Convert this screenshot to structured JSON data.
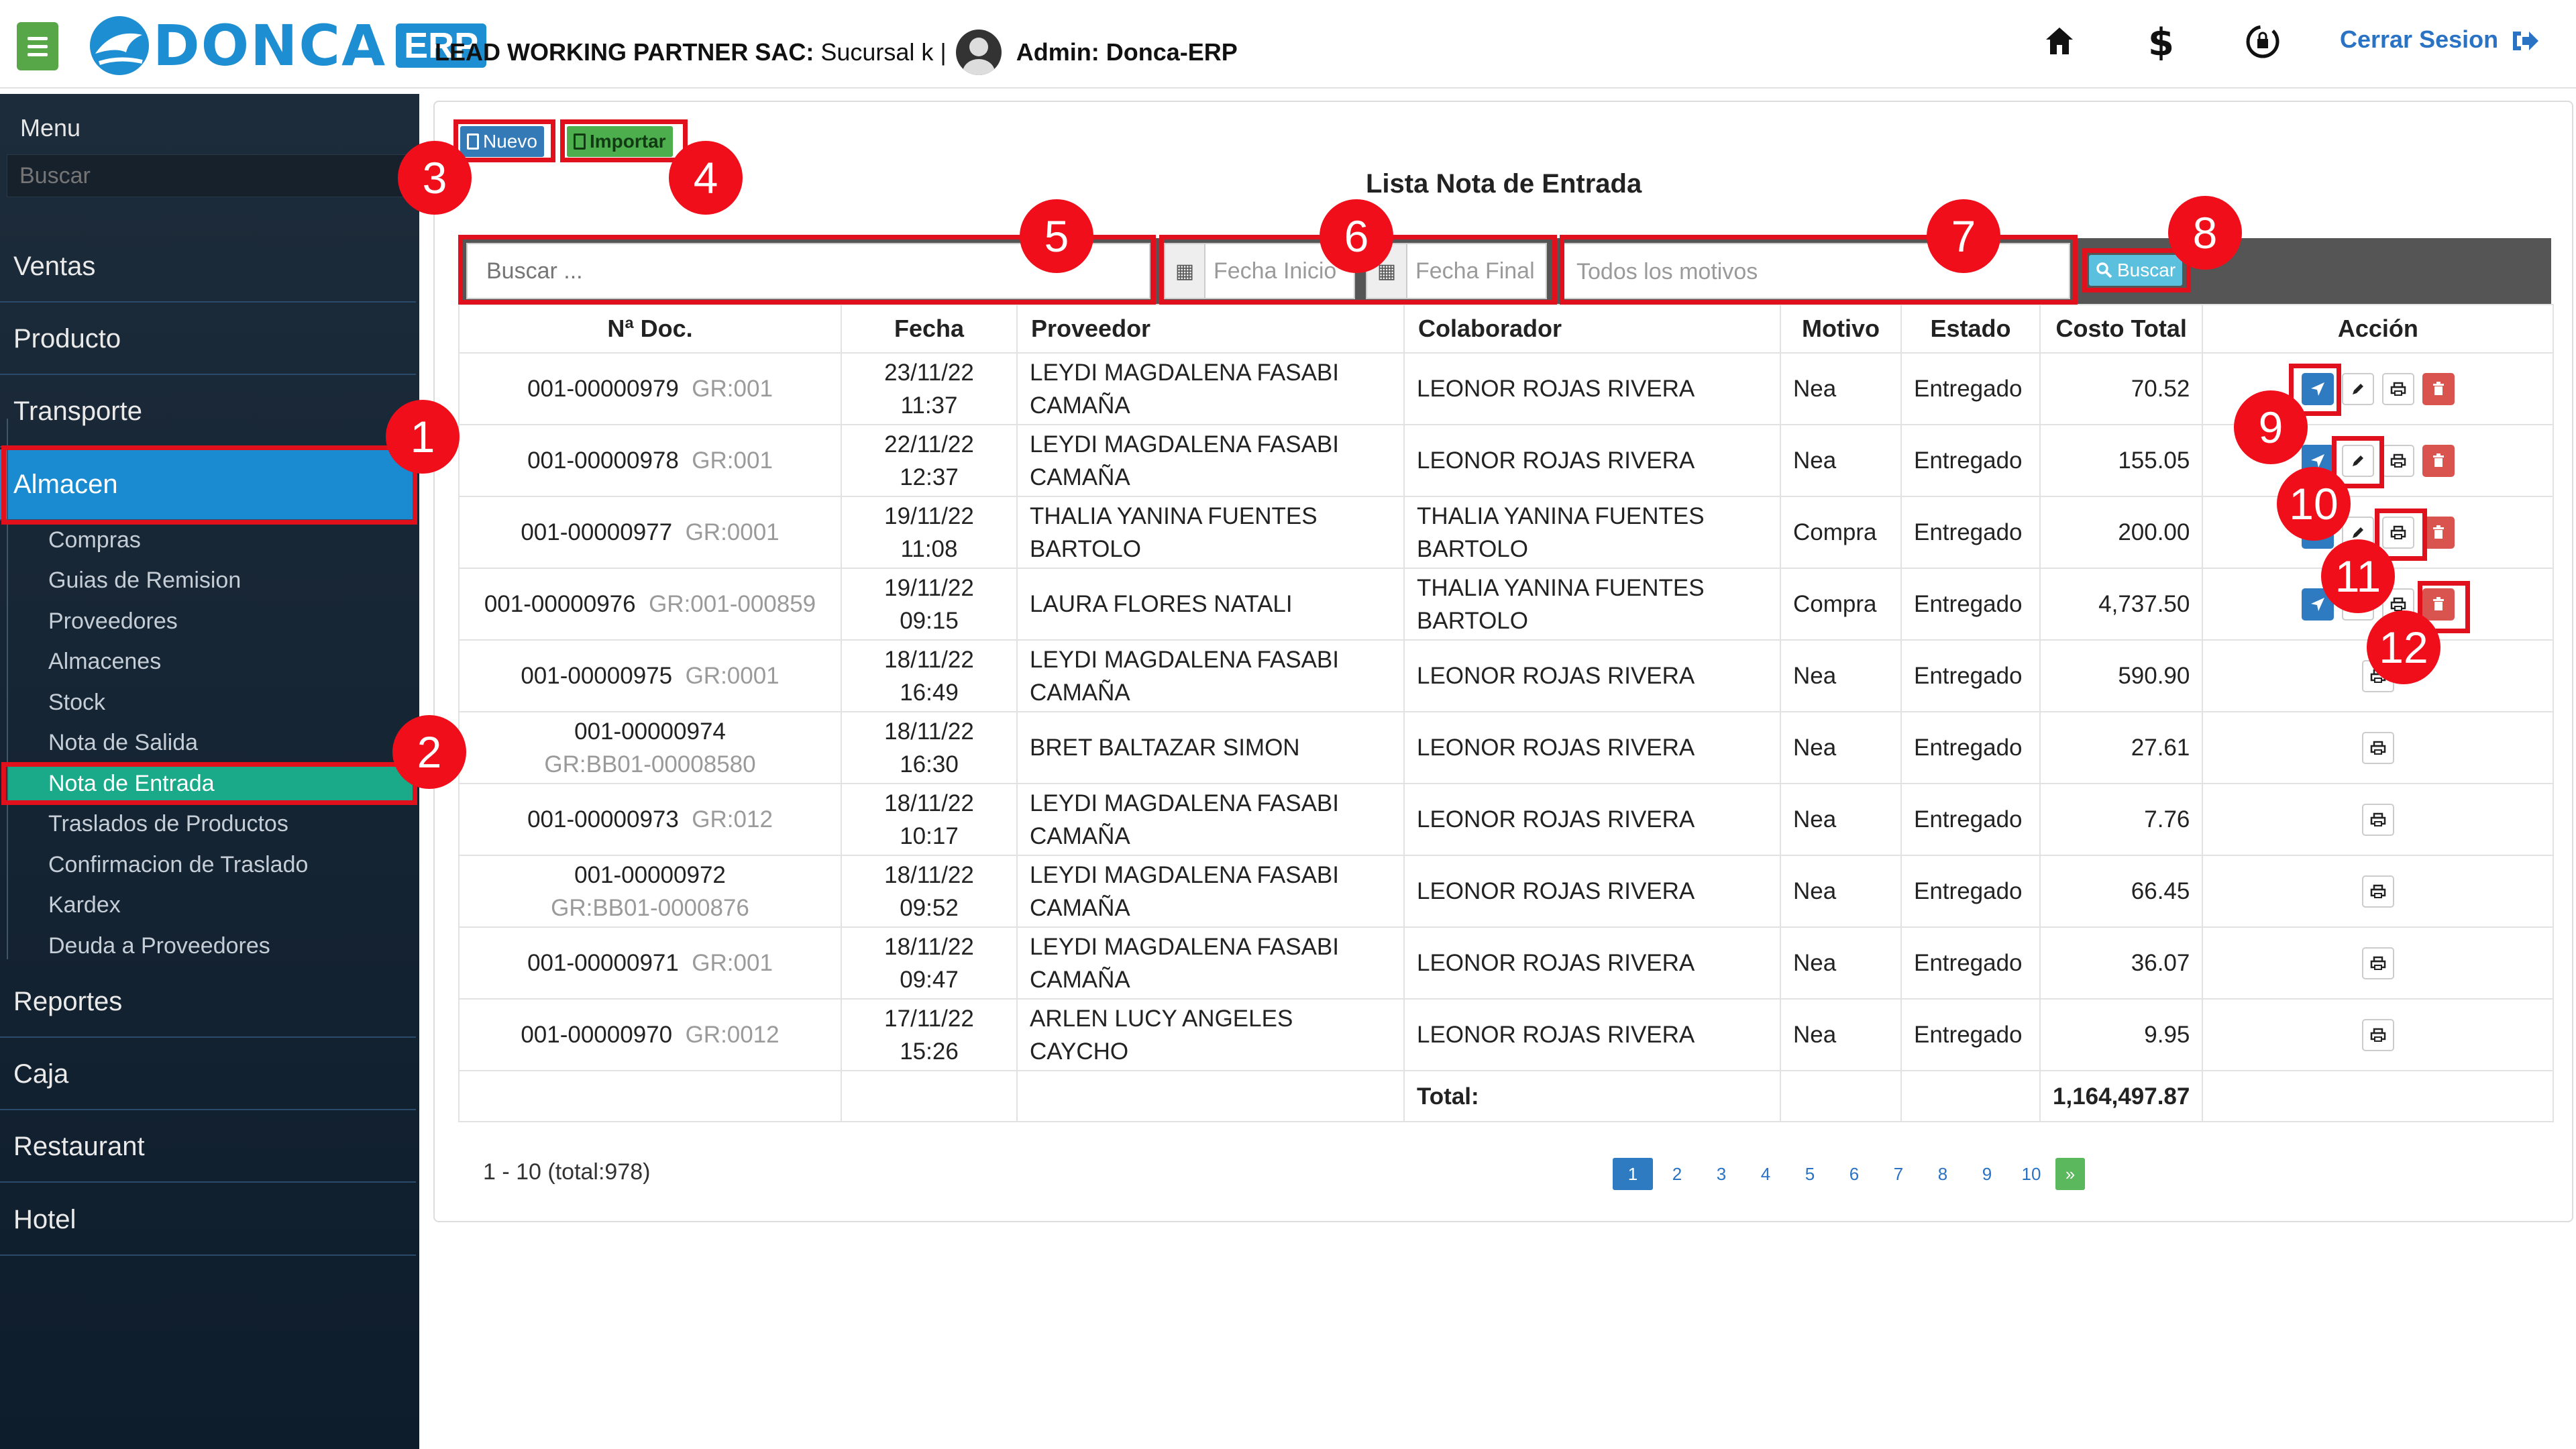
{
  "header": {
    "logo_word": "DONCA",
    "logo_badge": "ERP",
    "company_name": "LEAD WORKING PARTNER SAC:",
    "branch": "Sucursal k |",
    "admin_label": "Admin: Donca-ERP",
    "logout_label": "Cerrar Sesion"
  },
  "sidebar": {
    "menu_title": "Menu",
    "search_placeholder": "Buscar",
    "items": [
      "Ventas",
      "Producto",
      "Transporte",
      "Almacen",
      "Reportes",
      "Caja",
      "Restaurant",
      "Hotel"
    ],
    "active_item": "Almacen",
    "subitems": [
      "Compras",
      "Guias de Remision",
      "Proveedores",
      "Almacenes",
      "Stock",
      "Nota de Salida",
      "Nota de Entrada",
      "Traslados de Productos",
      "Confirmacion de Traslado",
      "Kardex",
      "Deuda a Proveedores"
    ],
    "active_subitem": "Nota de Entrada"
  },
  "toolbar": {
    "nuevo_label": "Nuevo",
    "importar_label": "Importar",
    "list_title": "Lista Nota de Entrada"
  },
  "filters": {
    "search_placeholder": "Buscar ...",
    "fecha_inicio_placeholder": "Fecha Inicio",
    "fecha_final_placeholder": "Fecha Final",
    "motivo_placeholder": "Todos los motivos",
    "buscar_label": "Buscar"
  },
  "table": {
    "headers": [
      "Nª Doc.",
      "Fecha",
      "Proveedor",
      "Colaborador",
      "Motivo",
      "Estado",
      "Costo Total",
      "Acción"
    ],
    "rows": [
      {
        "doc": "001-00000979",
        "gr": "GR:001",
        "date": "23/11/22",
        "time": "11:37",
        "proveedor": "LEYDI MAGDALENA FASABI CAMAÑA",
        "colaborador": "LEONOR ROJAS RIVERA",
        "motivo": "Nea",
        "estado": "Entregado",
        "costo": "70.52"
      },
      {
        "doc": "001-00000978",
        "gr": "GR:001",
        "date": "22/11/22",
        "time": "12:37",
        "proveedor": "LEYDI MAGDALENA FASABI CAMAÑA",
        "colaborador": "LEONOR ROJAS RIVERA",
        "motivo": "Nea",
        "estado": "Entregado",
        "costo": "155.05"
      },
      {
        "doc": "001-00000977",
        "gr": "GR:0001",
        "date": "19/11/22",
        "time": "11:08",
        "proveedor": "THALIA YANINA FUENTES BARTOLO",
        "colaborador": "THALIA YANINA FUENTES BARTOLO",
        "motivo": "Compra",
        "estado": "Entregado",
        "costo": "200.00"
      },
      {
        "doc": "001-00000976",
        "gr": "GR:001-000859",
        "date": "19/11/22",
        "time": "09:15",
        "proveedor": "LAURA FLORES NATALI",
        "colaborador": "THALIA YANINA FUENTES BARTOLO",
        "motivo": "Compra",
        "estado": "Entregado",
        "costo": "4,737.50"
      },
      {
        "doc": "001-00000975",
        "gr": "GR:0001",
        "date": "18/11/22",
        "time": "16:49",
        "proveedor": "LEYDI MAGDALENA FASABI CAMAÑA",
        "colaborador": "LEONOR ROJAS RIVERA",
        "motivo": "Nea",
        "estado": "Entregado",
        "costo": "590.90"
      },
      {
        "doc": "001-00000974",
        "gr": "GR:BB01-00008580",
        "date": "18/11/22",
        "time": "16:30",
        "proveedor": "BRET BALTAZAR SIMON",
        "colaborador": "LEONOR ROJAS RIVERA",
        "motivo": "Nea",
        "estado": "Entregado",
        "costo": "27.61"
      },
      {
        "doc": "001-00000973",
        "gr": "GR:012",
        "date": "18/11/22",
        "time": "10:17",
        "proveedor": "LEYDI MAGDALENA FASABI CAMAÑA",
        "colaborador": "LEONOR ROJAS RIVERA",
        "motivo": "Nea",
        "estado": "Entregado",
        "costo": "7.76"
      },
      {
        "doc": "001-00000972",
        "gr": "GR:BB01-0000876",
        "date": "18/11/22",
        "time": "09:52",
        "proveedor": "LEYDI MAGDALENA FASABI CAMAÑA",
        "colaborador": "LEONOR ROJAS RIVERA",
        "motivo": "Nea",
        "estado": "Entregado",
        "costo": "66.45"
      },
      {
        "doc": "001-00000971",
        "gr": "GR:001",
        "date": "18/11/22",
        "time": "09:47",
        "proveedor": "LEYDI MAGDALENA FASABI CAMAÑA",
        "colaborador": "LEONOR ROJAS RIVERA",
        "motivo": "Nea",
        "estado": "Entregado",
        "costo": "36.07"
      },
      {
        "doc": "001-00000970",
        "gr": "GR:0012",
        "date": "17/11/22",
        "time": "15:26",
        "proveedor": "ARLEN LUCY ANGELES CAYCHO",
        "colaborador": "LEONOR ROJAS RIVERA",
        "motivo": "Nea",
        "estado": "Entregado",
        "costo": "9.95"
      }
    ],
    "total_label": "Total:",
    "total_value": "1,164,497.87"
  },
  "pagination": {
    "info": "1 - 10 (total:978)",
    "pages": [
      "1",
      "2",
      "3",
      "4",
      "5",
      "6",
      "7",
      "8",
      "9",
      "10"
    ],
    "next": "»"
  },
  "annotations": [
    "1",
    "2",
    "3",
    "4",
    "5",
    "6",
    "7",
    "8",
    "9",
    "10",
    "11",
    "12"
  ],
  "colors": {
    "brand_blue": "#1d8ed1",
    "sidebar_active": "#1a8bd0",
    "subitem_active": "#1aaa8a",
    "annotation_red": "#e0101c",
    "delete_red": "#d9534f"
  }
}
